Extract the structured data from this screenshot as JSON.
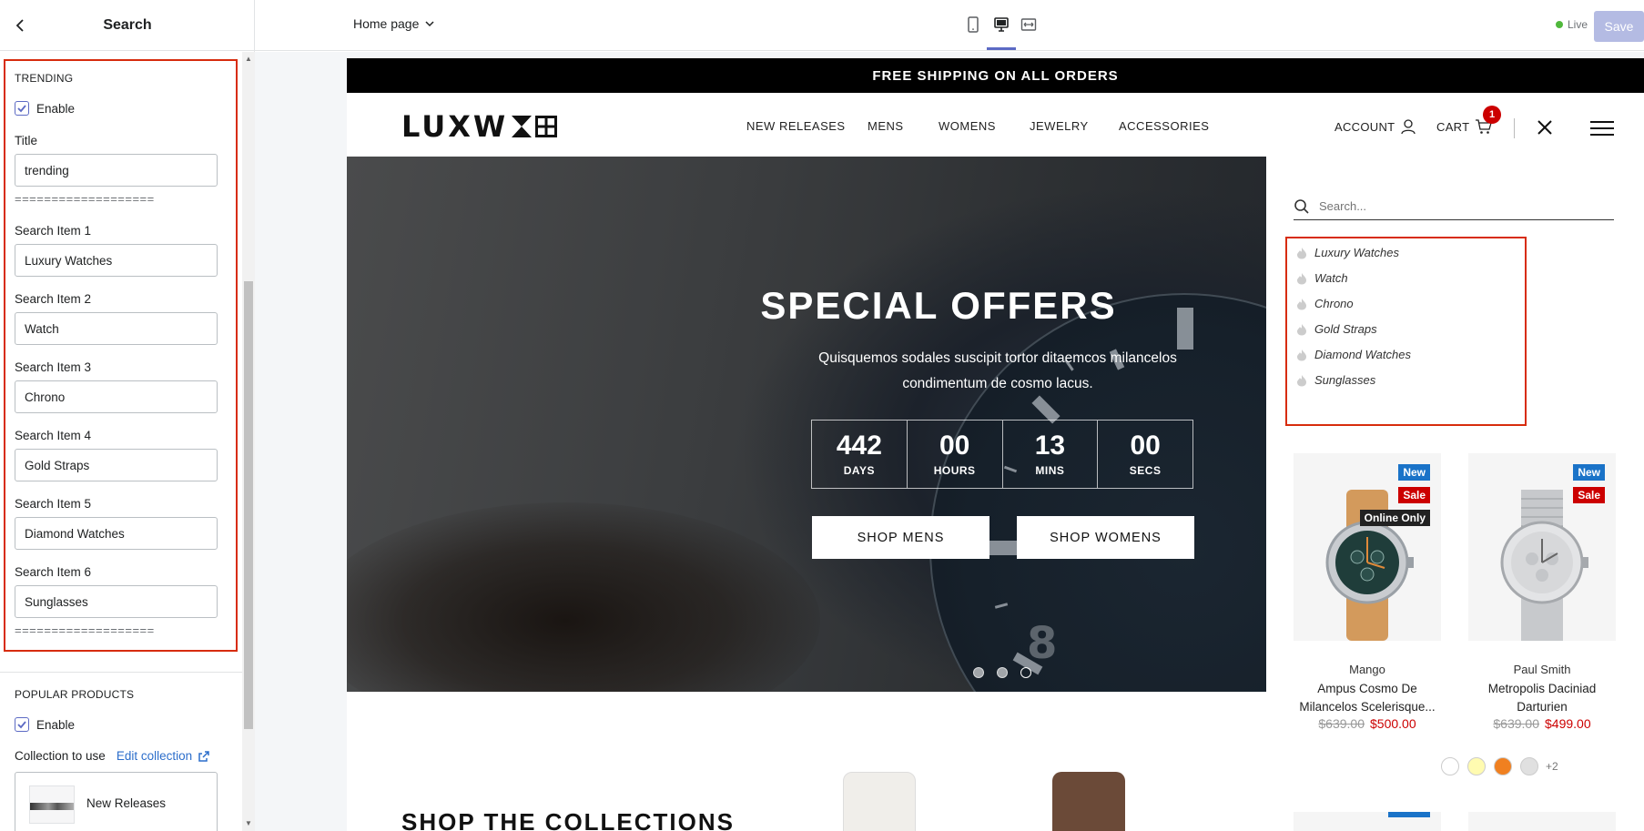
{
  "sidebar": {
    "title": "Search",
    "trending": {
      "section_title": "TRENDING",
      "enable_label": "Enable",
      "title_label": "Title",
      "title_value": "trending",
      "divider": "===================",
      "items": [
        {
          "label": "Search Item 1",
          "value": "Luxury Watches"
        },
        {
          "label": "Search Item 2",
          "value": "Watch"
        },
        {
          "label": "Search Item 3",
          "value": "Chrono"
        },
        {
          "label": "Search Item 4",
          "value": "Gold Straps"
        },
        {
          "label": "Search Item 5",
          "value": "Diamond Watches"
        },
        {
          "label": "Search Item 6",
          "value": "Sunglasses"
        }
      ]
    },
    "popular": {
      "section_title": "POPULAR PRODUCTS",
      "enable_label": "Enable",
      "collection_label": "Collection to use",
      "edit_link": "Edit collection",
      "collection_name": "New Releases"
    }
  },
  "topbar": {
    "page_select": "Home page",
    "live_label": "Live",
    "save_label": "Save"
  },
  "store": {
    "announcement": "FREE SHIPPING ON ALL ORDERS",
    "logo_text": "LUXW",
    "nav": [
      "NEW RELEASES",
      "MENS",
      "WOMENS",
      "JEWELRY",
      "ACCESSORIES"
    ],
    "account_label": "ACCOUNT",
    "cart_label": "CART",
    "cart_count": "1",
    "hero": {
      "title": "SPECIAL OFFERS",
      "text": "Quisquemos sodales suscipit tortor ditaemcos milancelos condimentum de cosmo lacus.",
      "countdown": [
        {
          "value": "442",
          "label": "DAYS"
        },
        {
          "value": "00",
          "label": "HOURS"
        },
        {
          "value": "13",
          "label": "MINS"
        },
        {
          "value": "00",
          "label": "SECS"
        }
      ],
      "button_mens": "SHOP MENS",
      "button_womens": "SHOP WOMENS",
      "dial_number": "8"
    },
    "collections_heading": "SHOP THE COLLECTIONS",
    "search": {
      "placeholder": "Search...",
      "trending_items": [
        "Luxury Watches",
        "Watch",
        "Chrono",
        "Gold Straps",
        "Diamond Watches",
        "Sunglasses"
      ]
    },
    "products": [
      {
        "badges": [
          "New",
          "Sale",
          "Online Only"
        ],
        "vendor": "Mango",
        "title_line1": "Ampus Cosmo De",
        "title_line2": "Milancelos Scelerisque...",
        "old_price": "$639.00",
        "price": "$500.00"
      },
      {
        "badges": [
          "New",
          "Sale"
        ],
        "vendor": "Paul Smith",
        "title_line1": "Metropolis Daciniad",
        "title_line2": "Darturien",
        "old_price": "$639.00",
        "price": "$499.00",
        "swatch_more": "+2",
        "swatch_colors": [
          "#ffffff",
          "#fffbb0",
          "#f08020",
          "#e0e0e0"
        ]
      }
    ]
  },
  "colors": {
    "accent": "#5c6ac4",
    "highlight_border": "#d72c0d",
    "sale_red": "#cc0000",
    "new_badge": "#1a73c8"
  }
}
